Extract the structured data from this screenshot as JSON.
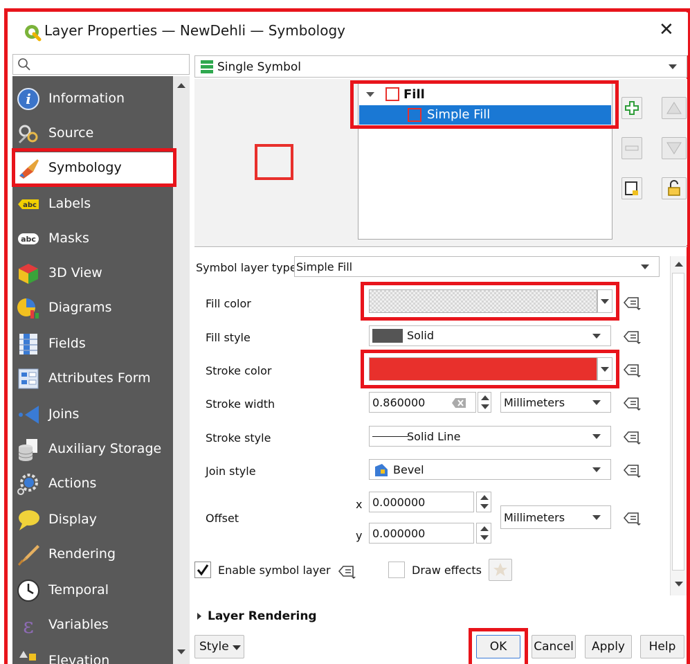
{
  "window": {
    "title": "Layer Properties — NewDehli — Symbology",
    "close": "✕"
  },
  "search": {
    "placeholder": ""
  },
  "sidebar": {
    "items": [
      {
        "label": "Information",
        "icon": "info-icon"
      },
      {
        "label": "Source",
        "icon": "source-icon"
      },
      {
        "label": "Symbology",
        "icon": "paintbrush-icon"
      },
      {
        "label": "Labels",
        "icon": "labels-abc-icon"
      },
      {
        "label": "Masks",
        "icon": "masks-abc-icon"
      },
      {
        "label": "3D View",
        "icon": "cube-icon"
      },
      {
        "label": "Diagrams",
        "icon": "diagrams-icon"
      },
      {
        "label": "Fields",
        "icon": "fields-icon"
      },
      {
        "label": "Attributes Form",
        "icon": "form-icon"
      },
      {
        "label": "Joins",
        "icon": "joins-icon"
      },
      {
        "label": "Auxiliary Storage",
        "icon": "database-icon"
      },
      {
        "label": "Actions",
        "icon": "actions-gear-icon"
      },
      {
        "label": "Display",
        "icon": "speech-bubble-icon"
      },
      {
        "label": "Rendering",
        "icon": "brush-icon"
      },
      {
        "label": "Temporal",
        "icon": "clock-icon"
      },
      {
        "label": "Variables",
        "icon": "epsilon-icon"
      },
      {
        "label": "Elevation",
        "icon": "elevation-icon"
      }
    ]
  },
  "renderer": {
    "value": "Single Symbol"
  },
  "symbol_tree": {
    "root": "Fill",
    "child": "Simple Fill"
  },
  "props": {
    "symbol_layer_type_label": "Symbol layer type",
    "symbol_layer_type_value": "Simple Fill",
    "fill_color_label": "Fill color",
    "fill_style_label": "Fill style",
    "fill_style_value": "Solid",
    "stroke_color_label": "Stroke color",
    "stroke_color_hex": "#e8302c",
    "stroke_width_label": "Stroke width",
    "stroke_width_value": "0.860000",
    "stroke_width_unit": "Millimeters",
    "stroke_style_label": "Stroke style",
    "stroke_style_value": "Solid Line",
    "join_style_label": "Join style",
    "join_style_value": "Bevel",
    "offset_label": "Offset",
    "offset_x_label": "x",
    "offset_x_value": "0.000000",
    "offset_y_label": "y",
    "offset_y_value": "0.000000",
    "offset_unit": "Millimeters",
    "enable_symbol_layer": "Enable symbol layer",
    "draw_effects": "Draw effects"
  },
  "layer_rendering": "Layer Rendering",
  "buttons": {
    "style": "Style",
    "ok": "OK",
    "cancel": "Cancel",
    "apply": "Apply",
    "help": "Help"
  },
  "colors": {
    "highlight": "#e8141b",
    "sidebar_bg": "#595959",
    "selection": "#1a78d4"
  }
}
